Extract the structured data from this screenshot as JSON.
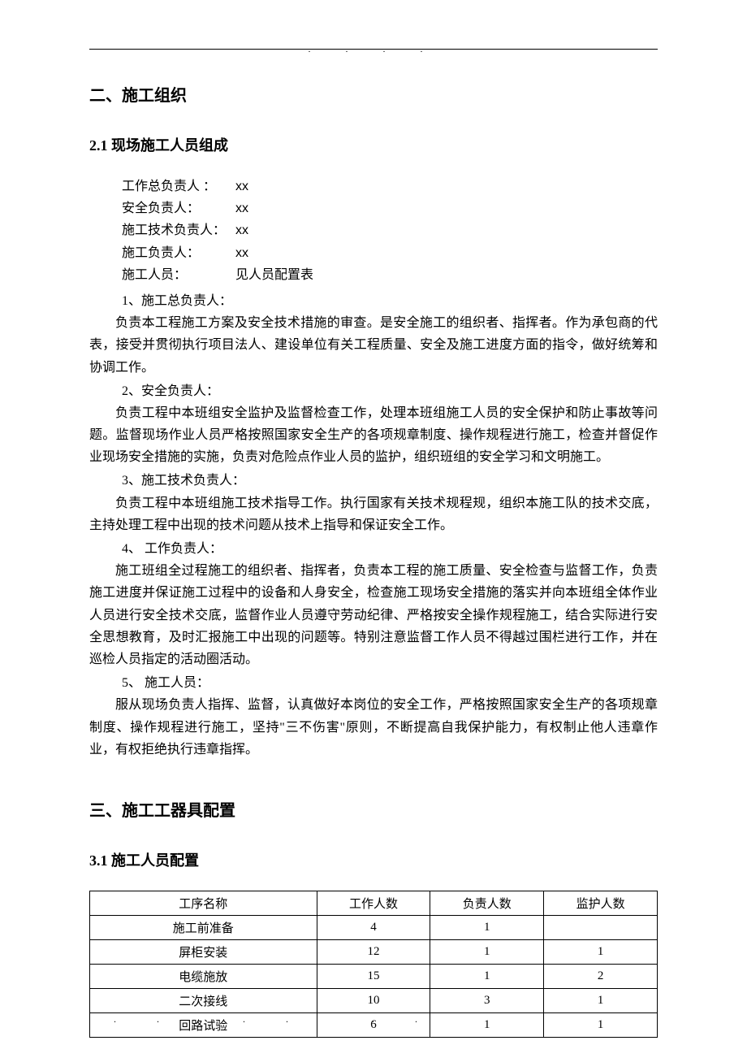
{
  "header": {
    "marks": ".    .           .    ."
  },
  "section2": {
    "title": "二、施工组织",
    "sub21": {
      "title": "2.1 现场施工人员组成",
      "personnel": [
        {
          "label": "工作总负责人 ：",
          "value": "xx"
        },
        {
          "label": "安全负责人：",
          "value": "xx"
        },
        {
          "label": "施工技术负责人：",
          "value": "xx"
        },
        {
          "label": "施工负责人：",
          "value": "xx"
        },
        {
          "label": "施工人员：",
          "value": "见人员配置表"
        }
      ],
      "roles": [
        {
          "num": "1、施工总负责人：",
          "desc": "负责本工程施工方案及安全技术措施的审查。是安全施工的组织者、指挥者。作为承包商的代表，接受并贯彻执行项目法人、建设单位有关工程质量、安全及施工进度方面的指令，做好统筹和协调工作。"
        },
        {
          "num": "2、安全负责人：",
          "desc": "负责工程中本班组安全监护及监督检查工作，处理本班组施工人员的安全保护和防止事故等问题。监督现场作业人员严格按照国家安全生产的各项规章制度、操作规程进行施工，检查并督促作业现场安全措施的实施，负责对危险点作业人员的监护，组织班组的安全学习和文明施工。"
        },
        {
          "num": "3、施工技术负责人：",
          "desc": "负责工程中本班组施工技术指导工作。执行国家有关技术规程规，组织本施工队的技术交底，主持处理工程中出现的技术问题从技术上指导和保证安全工作。"
        },
        {
          "num": "4、 工作负责人：",
          "desc": "施工班组全过程施工的组织者、指挥者，负责本工程的施工质量、安全检查与监督工作，负责施工进度并保证施工过程中的设备和人身安全，检查施工现场安全措施的落实并向本班组全体作业人员进行安全技术交底，监督作业人员遵守劳动纪律、严格按安全操作规程施工，结合实际进行安全思想教育，及时汇报施工中出现的问题等。特别注意监督工作人员不得越过围栏进行工作，并在巡检人员指定的活动圈活动。"
        },
        {
          "num": "5、 施工人员：",
          "desc": "服从现场负责人指挥、监督，认真做好本岗位的安全工作，严格按照国家安全生产的各项规章制度、操作规程进行施工，坚持\"三不伤害\"原则，不断提高自我保护能力，有权制止他人违章作业，有权拒绝执行违章指挥。"
        }
      ]
    }
  },
  "section3": {
    "title": "三、施工工器具配置",
    "sub31": {
      "title": "3.1 施工人员配置",
      "table": {
        "headers": [
          "工序名称",
          "工作人数",
          "负责人数",
          "监护人数"
        ],
        "rows": [
          [
            "施工前准备",
            "4",
            "1",
            ""
          ],
          [
            "屏柜安装",
            "12",
            "1",
            "1"
          ],
          [
            "电缆施放",
            "15",
            "1",
            "2"
          ],
          [
            "二次接线",
            "10",
            "3",
            "1"
          ],
          [
            "回路试验",
            "6",
            "1",
            "1"
          ]
        ]
      }
    }
  },
  "footer": {
    "dots": ".. .. .."
  }
}
